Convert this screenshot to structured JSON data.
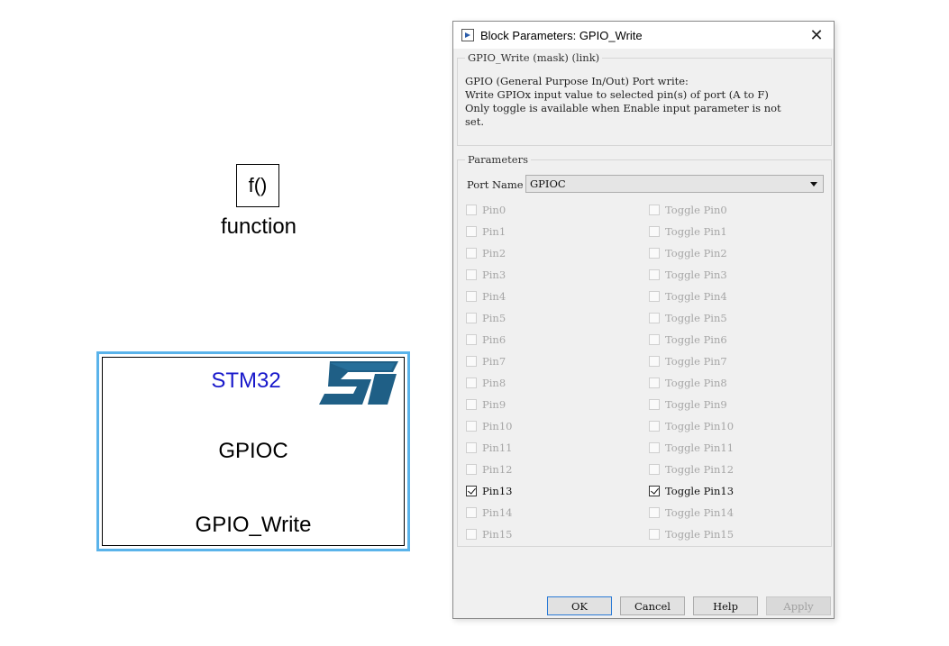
{
  "canvas": {
    "function_block": {
      "symbol": "f()",
      "label": "function"
    },
    "stm32_block": {
      "title": "STM32",
      "port": "GPIOC",
      "name": "GPIO_Write",
      "logo_text": "ST"
    }
  },
  "dialog": {
    "title": "Block Parameters: GPIO_Write",
    "close_icon": "close-icon",
    "mask_group": {
      "legend": "GPIO_Write (mask) (link)",
      "description": "GPIO (General Purpose In/Out) Port write:\nWrite GPIOx input value to selected pin(s) of port (A to F)\nOnly toggle is available when Enable input parameter is not\nset."
    },
    "params_group": {
      "legend": "Parameters",
      "port_label": "Port Name",
      "port_value": "GPIOC",
      "pins": [
        {
          "label": "Pin0",
          "checked": false,
          "enabled": false
        },
        {
          "label": "Pin1",
          "checked": false,
          "enabled": false
        },
        {
          "label": "Pin2",
          "checked": false,
          "enabled": false
        },
        {
          "label": "Pin3",
          "checked": false,
          "enabled": false
        },
        {
          "label": "Pin4",
          "checked": false,
          "enabled": false
        },
        {
          "label": "Pin5",
          "checked": false,
          "enabled": false
        },
        {
          "label": "Pin6",
          "checked": false,
          "enabled": false
        },
        {
          "label": "Pin7",
          "checked": false,
          "enabled": false
        },
        {
          "label": "Pin8",
          "checked": false,
          "enabled": false
        },
        {
          "label": "Pin9",
          "checked": false,
          "enabled": false
        },
        {
          "label": "Pin10",
          "checked": false,
          "enabled": false
        },
        {
          "label": "Pin11",
          "checked": false,
          "enabled": false
        },
        {
          "label": "Pin12",
          "checked": false,
          "enabled": false
        },
        {
          "label": "Pin13",
          "checked": true,
          "enabled": true
        },
        {
          "label": "Pin14",
          "checked": false,
          "enabled": false
        },
        {
          "label": "Pin15",
          "checked": false,
          "enabled": false
        }
      ],
      "toggles": [
        {
          "label": "Toggle Pin0",
          "checked": false,
          "enabled": false
        },
        {
          "label": "Toggle Pin1",
          "checked": false,
          "enabled": false
        },
        {
          "label": "Toggle Pin2",
          "checked": false,
          "enabled": false
        },
        {
          "label": "Toggle Pin3",
          "checked": false,
          "enabled": false
        },
        {
          "label": "Toggle Pin4",
          "checked": false,
          "enabled": false
        },
        {
          "label": "Toggle Pin5",
          "checked": false,
          "enabled": false
        },
        {
          "label": "Toggle Pin6",
          "checked": false,
          "enabled": false
        },
        {
          "label": "Toggle Pin7",
          "checked": false,
          "enabled": false
        },
        {
          "label": "Toggle Pin8",
          "checked": false,
          "enabled": false
        },
        {
          "label": "Toggle Pin9",
          "checked": false,
          "enabled": false
        },
        {
          "label": "Toggle Pin10",
          "checked": false,
          "enabled": false
        },
        {
          "label": "Toggle Pin11",
          "checked": false,
          "enabled": false
        },
        {
          "label": "Toggle Pin12",
          "checked": false,
          "enabled": false
        },
        {
          "label": "Toggle Pin13",
          "checked": true,
          "enabled": true
        },
        {
          "label": "Toggle Pin14",
          "checked": false,
          "enabled": false
        },
        {
          "label": "Toggle Pin15",
          "checked": false,
          "enabled": false
        }
      ]
    },
    "buttons": {
      "ok": "OK",
      "cancel": "Cancel",
      "help": "Help",
      "apply": "Apply"
    }
  },
  "colors": {
    "selection": "#5ab3ea",
    "stm32_title": "#1a1acb",
    "st_logo": "#1f5f86",
    "ok_focus": "#2a7ad6"
  }
}
